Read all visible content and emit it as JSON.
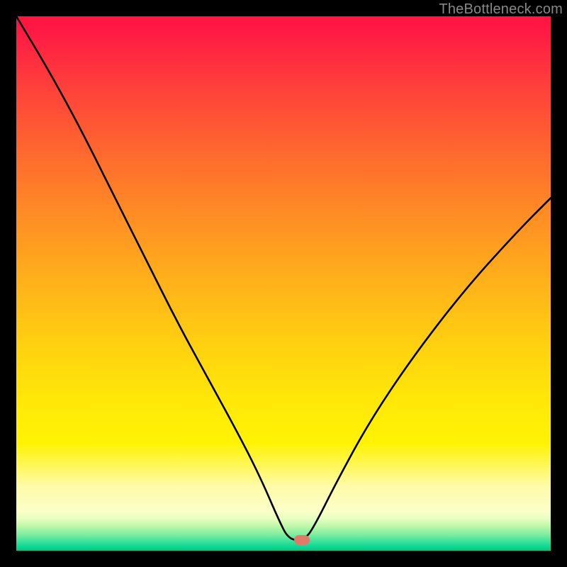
{
  "watermark": "TheBottleneck.com",
  "marker": {
    "x_pct": 53.5,
    "y_pct": 98.0
  },
  "chart_data": {
    "type": "line",
    "title": "",
    "xlabel": "",
    "ylabel": "",
    "xlim": [
      0,
      100
    ],
    "ylim": [
      0,
      100
    ],
    "series": [
      {
        "name": "bottleneck-curve",
        "x": [
          0,
          6,
          12,
          18,
          24,
          30,
          36,
          42,
          46,
          49,
          51,
          54,
          56,
          60,
          66,
          74,
          84,
          94,
          100
        ],
        "y": [
          100,
          90,
          79,
          67,
          55,
          43,
          32,
          21,
          13,
          6,
          2,
          2,
          5,
          13,
          24,
          36,
          49,
          60,
          66
        ]
      }
    ],
    "annotations": [
      {
        "type": "marker",
        "x": 53.5,
        "y": 2,
        "label": "optimal-point"
      }
    ],
    "background": {
      "type": "vertical-gradient",
      "stops": [
        {
          "pct": 0,
          "color": "#ff1440"
        },
        {
          "pct": 50,
          "color": "#ffb21a"
        },
        {
          "pct": 80,
          "color": "#fff305"
        },
        {
          "pct": 95,
          "color": "#baf7a8"
        },
        {
          "pct": 100,
          "color": "#00c882"
        }
      ]
    }
  }
}
